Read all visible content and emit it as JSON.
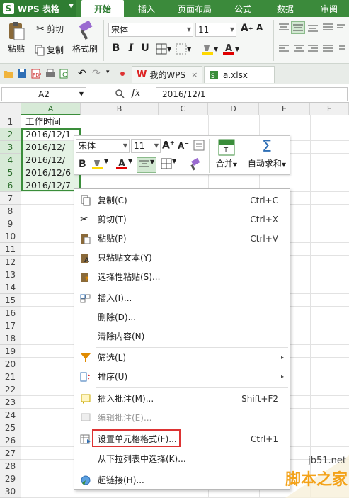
{
  "app": {
    "name": "WPS 表格",
    "logo_letter": "S"
  },
  "menu_tabs": [
    "开始",
    "插入",
    "页面布局",
    "公式",
    "数据",
    "审阅"
  ],
  "active_tab": "开始",
  "ribbon": {
    "paste": "粘贴",
    "cut": "剪切",
    "copy": "复制",
    "format_painter": "格式刷",
    "font": "宋体",
    "size": "11",
    "bold": "B",
    "italic": "I",
    "underline": "U"
  },
  "doc_tabs": [
    {
      "label": "我的WPS"
    },
    {
      "label": "a.xlsx"
    }
  ],
  "formula_bar": {
    "cell_ref": "A2",
    "fx": "fx",
    "value": "2016/12/1"
  },
  "columns": [
    "A",
    "B",
    "C",
    "D",
    "E",
    "F"
  ],
  "rows": [
    "1",
    "2",
    "3",
    "4",
    "5",
    "6",
    "7",
    "8",
    "9",
    "10",
    "11",
    "12",
    "13",
    "14",
    "15",
    "16",
    "17",
    "18",
    "19",
    "20",
    "21",
    "22",
    "23",
    "24",
    "25",
    "26",
    "27",
    "28",
    "29",
    "30"
  ],
  "cells_col_a": [
    "工作时间",
    "2016/12/1",
    "2016/12/",
    "2016/12/",
    "2016/12/6",
    "2016/12/7"
  ],
  "mini_toolbar": {
    "font": "宋体",
    "size": "11",
    "bold": "B",
    "merge": "合并",
    "autosum": "自动求和"
  },
  "context_menu": [
    {
      "label": "复制(C)",
      "shortcut": "Ctrl+C"
    },
    {
      "label": "剪切(T)",
      "shortcut": "Ctrl+X"
    },
    {
      "label": "粘贴(P)",
      "shortcut": "Ctrl+V"
    },
    {
      "label": "只粘贴文本(Y)",
      "shortcut": ""
    },
    {
      "label": "选择性粘贴(S)...",
      "shortcut": ""
    },
    {
      "label": "插入(I)...",
      "shortcut": ""
    },
    {
      "label": "删除(D)...",
      "shortcut": ""
    },
    {
      "label": "清除内容(N)",
      "shortcut": ""
    },
    {
      "label": "筛选(L)",
      "shortcut": ""
    },
    {
      "label": "排序(U)",
      "shortcut": ""
    },
    {
      "label": "插入批注(M)...",
      "shortcut": "Shift+F2"
    },
    {
      "label": "编辑批注(E)...",
      "shortcut": ""
    },
    {
      "label": "设置单元格格式(F)...",
      "shortcut": "Ctrl+1"
    },
    {
      "label": "从下拉列表中选择(K)...",
      "shortcut": ""
    },
    {
      "label": "超链接(H)...",
      "shortcut": ""
    }
  ],
  "watermark": {
    "site": "jb51.net",
    "brand": "脚本之家"
  },
  "colors": {
    "accent": "#3b8a3b",
    "highlight_border": "#d33333"
  }
}
